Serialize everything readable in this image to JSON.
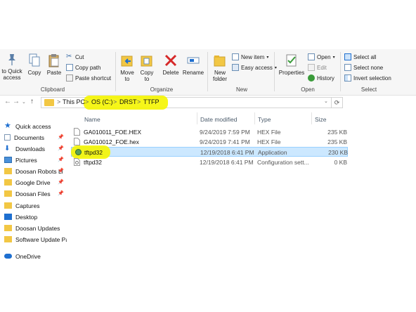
{
  "ribbon": {
    "clipboard": {
      "pin_label": "to Quick access",
      "copy_label": "Copy",
      "paste_label": "Paste",
      "cut_label": "Cut",
      "copy_path_label": "Copy path",
      "paste_shortcut_label": "Paste shortcut",
      "group_label": "Clipboard"
    },
    "organize": {
      "move_to_label": "Move to",
      "copy_to_label": "Copy to",
      "delete_label": "Delete",
      "rename_label": "Rename",
      "group_label": "Organize"
    },
    "new": {
      "new_folder_label": "New folder",
      "new_item_label": "New item",
      "easy_access_label": "Easy access",
      "group_label": "New"
    },
    "open": {
      "properties_label": "Properties",
      "open_label": "Open",
      "edit_label": "Edit",
      "history_label": "History",
      "group_label": "Open"
    },
    "select": {
      "select_all_label": "Select all",
      "select_none_label": "Select none",
      "invert_selection_label": "Invert selection",
      "group_label": "Select"
    }
  },
  "address": {
    "crumbs": [
      "This PC",
      "OS (C:)",
      "DRST",
      "TTFP"
    ],
    "separator": ">"
  },
  "nav_pane": {
    "items": [
      {
        "label": "Quick access",
        "icon": "star-icon",
        "pinned": false
      },
      {
        "label": "Documents",
        "icon": "documents-icon",
        "pinned": true
      },
      {
        "label": "Downloads",
        "icon": "downloads-icon",
        "pinned": true
      },
      {
        "label": "Pictures",
        "icon": "pictures-icon",
        "pinned": true
      },
      {
        "label": "Doosan Robots Li",
        "icon": "folder-icon",
        "pinned": true
      },
      {
        "label": "Google Drive",
        "icon": "folder-icon",
        "pinned": true
      },
      {
        "label": "Doosan Files",
        "icon": "folder-icon",
        "pinned": true
      },
      {
        "label": "Captures",
        "icon": "folder-icon",
        "pinned": false
      },
      {
        "label": "Desktop",
        "icon": "desktop-icon",
        "pinned": false
      },
      {
        "label": "Doosan Updates",
        "icon": "folder-icon",
        "pinned": false
      },
      {
        "label": "Software Update Pa",
        "icon": "folder-icon",
        "pinned": false
      },
      {
        "label": "OneDrive",
        "icon": "cloud-icon",
        "pinned": false
      }
    ]
  },
  "file_list": {
    "columns": [
      "Name",
      "Date modified",
      "Type",
      "Size"
    ],
    "rows": [
      {
        "name": "GA010011_FOE.HEX",
        "date": "9/24/2019 7:59 PM",
        "type": "HEX File",
        "size": "235 KB",
        "icon": "file-icon",
        "selected": false
      },
      {
        "name": "GA010012_FOE.hex",
        "date": "9/24/2019 7:41 PM",
        "type": "HEX File",
        "size": "235 KB",
        "icon": "file-icon",
        "selected": false
      },
      {
        "name": "tftpd32",
        "date": "12/19/2018 6:41 PM",
        "type": "Application",
        "size": "230 KB",
        "icon": "application-icon",
        "selected": true
      },
      {
        "name": "tftpd32",
        "date": "12/19/2018 6:41 PM",
        "type": "Configuration sett...",
        "size": "0 KB",
        "icon": "config-file-icon",
        "selected": false
      }
    ]
  },
  "colors": {
    "highlight": "#f5f500",
    "selection_bg": "#cce8ff",
    "folder": "#f2c744",
    "delete_red": "#d62828",
    "accent_blue": "#1e6fd0"
  }
}
